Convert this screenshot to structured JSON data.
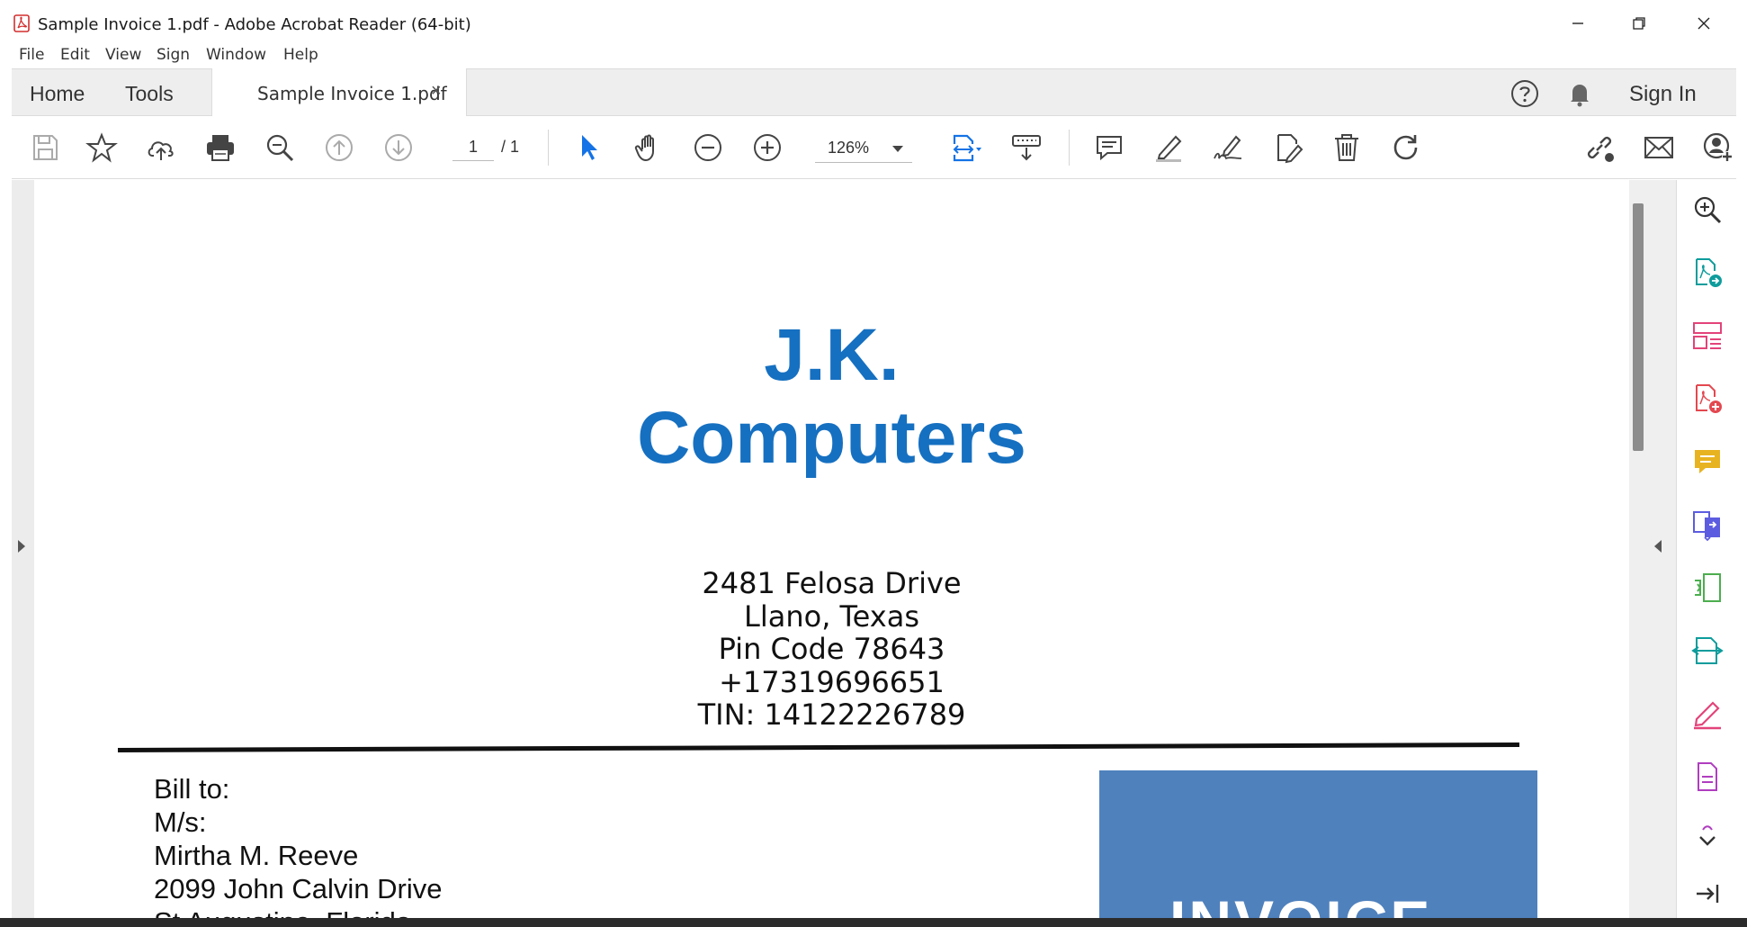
{
  "window": {
    "title": "Sample Invoice 1.pdf - Adobe Acrobat Reader (64-bit)"
  },
  "menu": [
    "File",
    "Edit",
    "View",
    "Sign",
    "Window",
    "Help"
  ],
  "tabs": {
    "home": "Home",
    "tools": "Tools",
    "document": "Sample Invoice 1.pdf",
    "close": "×",
    "sign_in": "Sign In"
  },
  "toolbar": {
    "page_current": "1",
    "page_total": "/ 1",
    "zoom": "126%"
  },
  "document": {
    "company_line1": "J.K.",
    "company_line2": "Computers",
    "address": [
      "2481 Felosa Drive",
      "Llano, Texas",
      "Pin Code 78643",
      "+17319696651",
      "TIN: 14122226789"
    ],
    "bill_to": [
      "Bill to:",
      "M/s:",
      "Mirtha M. Reeve",
      "2099 John Calvin Drive",
      "St Augustine, Florida"
    ],
    "invoice_label": "INVOICE"
  },
  "colors": {
    "brand_blue": "#1670c1",
    "invoice_box": "#4f81bd",
    "tool_blue": "#1473e6",
    "acrobat_red": "#d32f2f"
  }
}
